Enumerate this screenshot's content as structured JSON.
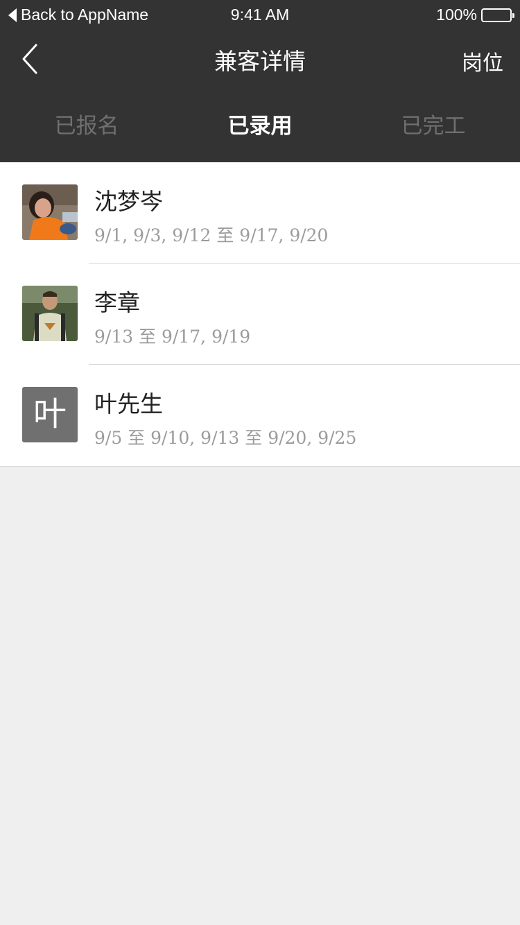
{
  "status_bar": {
    "back_app": "Back to AppName",
    "time": "9:41 AM",
    "battery": "100%"
  },
  "nav": {
    "title": "兼客详情",
    "right_label": "岗位"
  },
  "tabs": [
    {
      "label": "已报名",
      "active": false
    },
    {
      "label": "已录用",
      "active": true
    },
    {
      "label": "已完工",
      "active": false
    }
  ],
  "workers": [
    {
      "name": "沈梦岑",
      "dates": "9/1, 9/3, 9/12 至 9/17, 9/20",
      "avatar": "photo-woman-orange"
    },
    {
      "name": "李章",
      "dates": "9/13 至 9/17, 9/19",
      "avatar": "photo-man-backpack"
    },
    {
      "name": "叶先生",
      "dates": "9/5 至 9/10, 9/13 至 9/20, 9/25",
      "avatar_text": "叶"
    }
  ],
  "colors": {
    "header_bg": "#333333",
    "list_bg": "#ffffff",
    "page_bg": "#efefef",
    "inactive_tab": "#6f6f6f",
    "secondary_text": "#9b9b9b"
  }
}
